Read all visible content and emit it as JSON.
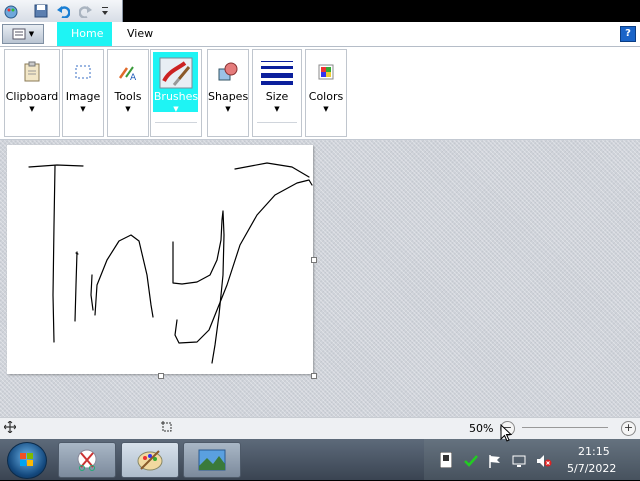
{
  "window": {
    "quick_access": [
      "paint-app-icon",
      "save-icon",
      "undo-icon",
      "redo-icon",
      "customize-dropdown-icon"
    ]
  },
  "ribbon": {
    "tabs": [
      {
        "label": "Home",
        "active": true
      },
      {
        "label": "View",
        "active": false
      }
    ],
    "groups": [
      {
        "label": "Clipboard",
        "icon": "clipboard-icon"
      },
      {
        "label": "Image",
        "icon": "image-select-icon"
      },
      {
        "label": "Tools",
        "icon": "tools-icon"
      },
      {
        "label": "Brushes",
        "icon": "brush-icon",
        "selected": true
      },
      {
        "label": "Shapes",
        "icon": "shapes-icon"
      },
      {
        "label": "Size",
        "icon": "size-lines-icon"
      },
      {
        "label": "Colors",
        "icon": "colors-icon"
      }
    ],
    "help_label": "?",
    "accent": "#1ef4f4"
  },
  "status": {
    "zoom": "50%",
    "zoom_minus": "−",
    "zoom_plus": "+"
  },
  "taskbar": {
    "buttons": [
      "snipping-tool-icon",
      "paint-icon",
      "image-viewer-icon"
    ],
    "tray_icons": [
      "note-icon",
      "security-check-icon",
      "flag-icon",
      "network-icon",
      "volume-muted-icon"
    ],
    "time": "21:15",
    "date": "5/7/2022"
  }
}
